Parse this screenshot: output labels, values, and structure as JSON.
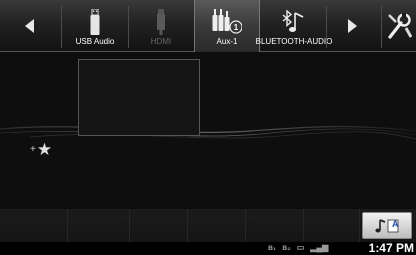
{
  "sources": {
    "usb": {
      "label": "USB Audio",
      "icon": "usb-stick-icon"
    },
    "hdmi": {
      "label": "HDMI",
      "icon": "hdmi-plug-icon"
    },
    "aux": {
      "label": "Aux-1",
      "badge": "1",
      "icon": "rca-plugs-icon"
    },
    "bluetooth": {
      "label": "BLUETOOTH-AUDIO",
      "icon": "bluetooth-note-icon"
    }
  },
  "nav": {
    "prev_icon": "triangle-left-icon",
    "next_icon": "triangle-right-icon"
  },
  "setup": {
    "icon": "setup-wrench-icon"
  },
  "favorite": {
    "plus": "+",
    "star": "★"
  },
  "mode_button": {
    "icon": "music-note-letter-icon",
    "letter": "A"
  },
  "status": {
    "time": "1:47 PM",
    "icons": [
      "bluetooth-phone-icon",
      "bluetooth-audio-icon",
      "battery-icon",
      "signal-icon"
    ]
  },
  "colors": {
    "active_tab": "#4a4a4a",
    "inactive_label": "#666666"
  }
}
